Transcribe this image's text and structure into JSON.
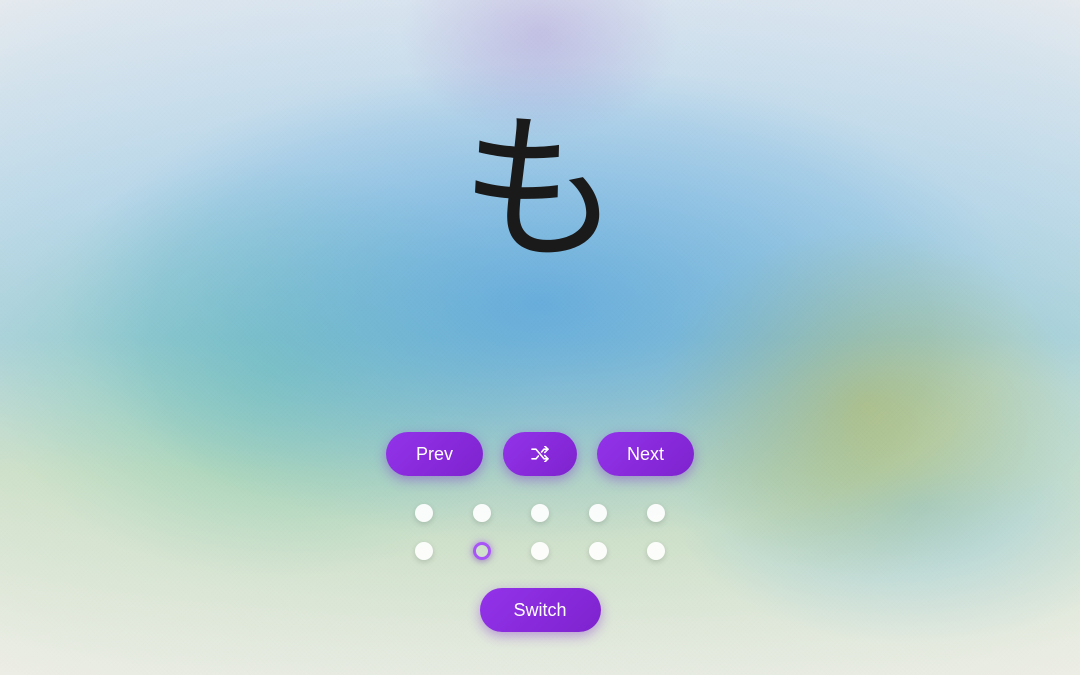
{
  "character": "も",
  "controls": {
    "prev_label": "Prev",
    "next_label": "Next",
    "switch_label": "Switch",
    "shuffle_icon": "shuffle"
  },
  "pagination": {
    "total": 10,
    "active_index": 6,
    "rows": [
      [
        0,
        1,
        2,
        3,
        4
      ],
      [
        5,
        6,
        7,
        8,
        9
      ]
    ]
  },
  "colors": {
    "accent": "#8b2fd6",
    "accent_gradient_start": "#9333ea",
    "accent_gradient_end": "#7e22ce"
  }
}
